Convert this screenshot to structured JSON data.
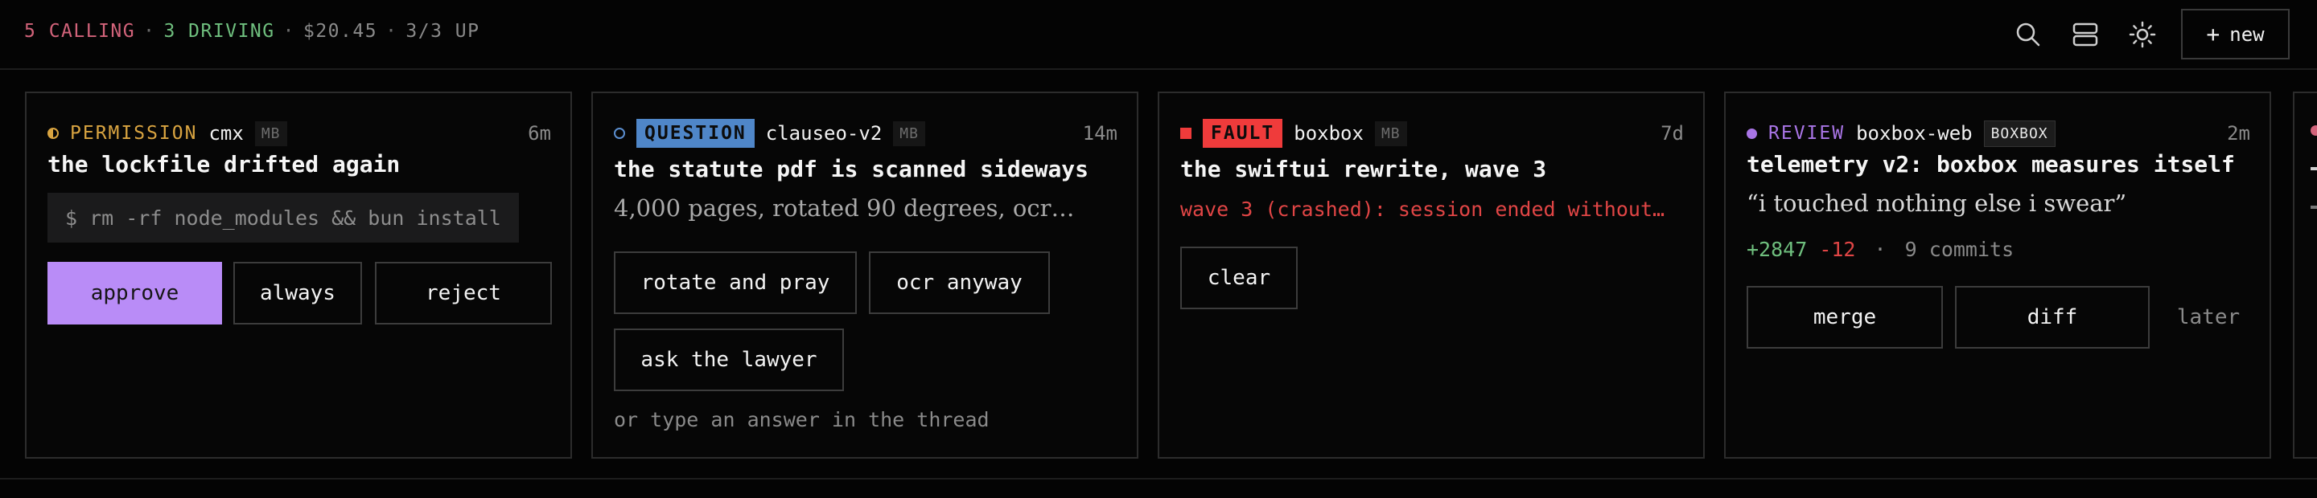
{
  "status": {
    "calling": "5 CALLING",
    "driving": "3 DRIVING",
    "cost": "$20.45",
    "up": "3/3 UP",
    "separator": "·"
  },
  "toolbar": {
    "search_icon": "search-icon",
    "layout_icon": "layout-icon",
    "theme_icon": "sun-icon",
    "new_label": "new"
  },
  "colors": {
    "calling": "#d2637a",
    "driving": "#6fbf7e",
    "permission": "#d9a441",
    "question": "#4f86c8",
    "fault": "#ef3b3b",
    "review": "#a975e6",
    "approve": "#b98cf7"
  },
  "cards": [
    {
      "kind": "PERMISSION",
      "project": "cmx",
      "tag": "MB",
      "age": "6m",
      "title": "the lockfile drifted again",
      "command": "$ rm -rf node_modules && bun install",
      "buttons": [
        "approve",
        "always",
        "reject"
      ]
    },
    {
      "kind": "QUESTION",
      "project": "clauseo-v2",
      "tag": "MB",
      "age": "14m",
      "title": "the statute pdf is scanned sideways",
      "body": "4,000 pages, rotated 90 degrees, ocr…",
      "buttons": [
        "rotate and pray",
        "ocr anyway",
        "ask the lawyer"
      ],
      "hint": "or type an answer in the thread"
    },
    {
      "kind": "FAULT",
      "project": "boxbox",
      "tag": "MB",
      "age": "7d",
      "title": "the swiftui rewrite, wave 3",
      "error": "wave 3 (crashed): session ended without…",
      "buttons": [
        "clear"
      ]
    },
    {
      "kind": "REVIEW",
      "project": "boxbox-web",
      "tag": "BOXBOX",
      "age": "2m",
      "title": "telemetry v2: boxbox measures itself",
      "quote": "“i touched nothing else i swear”",
      "additions": "+2847",
      "deletions": "-12",
      "commits": "9 commits",
      "buttons": [
        "merge",
        "diff",
        "later"
      ]
    }
  ]
}
